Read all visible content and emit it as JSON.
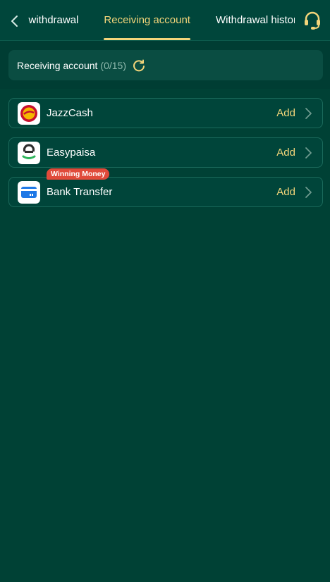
{
  "header": {
    "tabs": [
      {
        "label": "Last withdrawal"
      },
      {
        "label": "Receiving account",
        "active": true
      },
      {
        "label": "Withdrawal history"
      }
    ],
    "back_icon": "chevron-left-icon",
    "support_icon": "headset-icon"
  },
  "summary": {
    "title": "Receiving account",
    "count": "(0/15)"
  },
  "methods": [
    {
      "label": "JazzCash",
      "action": "Add"
    },
    {
      "label": "Easypaisa",
      "action": "Add"
    },
    {
      "label": "Bank Transfer",
      "action": "Add",
      "badge": "Winning Money"
    }
  ],
  "colors": {
    "background": "#003d33",
    "accent": "#f3d57a",
    "badge": "#e04a3a"
  }
}
